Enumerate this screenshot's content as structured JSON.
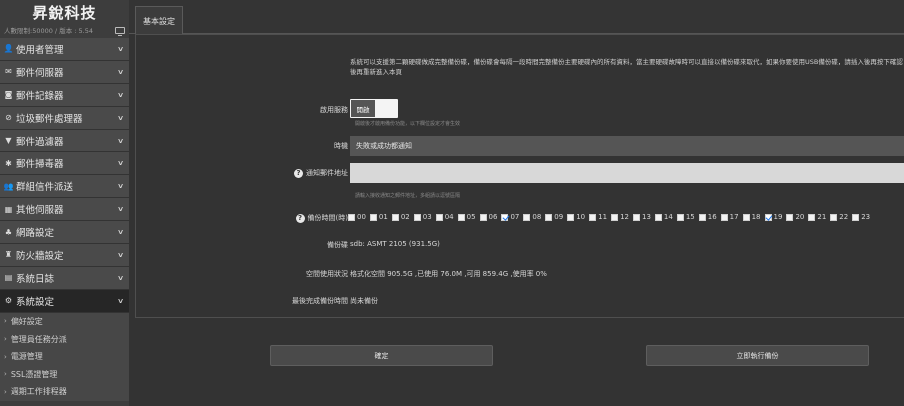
{
  "brand": {
    "title": "昇銳科技"
  },
  "quota": {
    "text": "人數限制:50000 / 版本 : 5.54"
  },
  "sidebar": {
    "items": [
      {
        "label": "使用者管理",
        "icon": "user-icon",
        "glyph": "👤"
      },
      {
        "label": "郵件伺服器",
        "icon": "envelope-icon",
        "glyph": "✉"
      },
      {
        "label": "郵件記錄器",
        "icon": "camera-icon",
        "glyph": "◙"
      },
      {
        "label": "垃圾郵件處理器",
        "icon": "ban-icon",
        "glyph": "⊘"
      },
      {
        "label": "郵件過濾器",
        "icon": "filter-icon",
        "glyph": "▼"
      },
      {
        "label": "郵件掃毒器",
        "icon": "bug-icon",
        "glyph": "✱"
      },
      {
        "label": "群組信件派送",
        "icon": "group-icon",
        "glyph": "👥"
      },
      {
        "label": "其他伺服器",
        "icon": "server-icon",
        "glyph": "▦"
      },
      {
        "label": "網路設定",
        "icon": "network-icon",
        "glyph": "♣"
      },
      {
        "label": "防火牆設定",
        "icon": "firewall-icon",
        "glyph": "♜"
      },
      {
        "label": "系統日誌",
        "icon": "log-icon",
        "glyph": "▤"
      },
      {
        "label": "系統設定",
        "icon": "cogs-icon",
        "glyph": "⚙"
      }
    ],
    "subitems": [
      "偏好設定",
      "管理員任務分派",
      "電源管理",
      "SSL憑證管理",
      "週期工作排程器"
    ]
  },
  "tab": {
    "label": "基本設定"
  },
  "description": "系統可以支援第二顆硬碟做成完整備份碟，備份碟會每隔一段時間完整備份主要硬碟內的所有資料，當主要硬碟故障時可以直接以備份碟來取代，如果你要使用USB備份碟，請插入後再按下確認後再重新進入本頁",
  "form": {
    "enable": {
      "label": "啟用服務",
      "toggle_text": "開啟",
      "hint": "開啟後才啟用備份功能，以下欄位設定才會生效"
    },
    "notify": {
      "label": "時機",
      "value": "失敗或成功都通知"
    },
    "email": {
      "label": "通知郵件地址",
      "value": "",
      "hint": "請輸入接收通知之郵件地址，多組請以逗號區隔"
    },
    "hours": {
      "label": "備份時間(時)",
      "items": [
        {
          "h": "00",
          "checked": false
        },
        {
          "h": "01",
          "checked": false
        },
        {
          "h": "02",
          "checked": false
        },
        {
          "h": "03",
          "checked": false
        },
        {
          "h": "04",
          "checked": false
        },
        {
          "h": "05",
          "checked": false
        },
        {
          "h": "06",
          "checked": false
        },
        {
          "h": "07",
          "checked": true
        },
        {
          "h": "08",
          "checked": false
        },
        {
          "h": "09",
          "checked": false
        },
        {
          "h": "10",
          "checked": false
        },
        {
          "h": "11",
          "checked": false
        },
        {
          "h": "12",
          "checked": false
        },
        {
          "h": "13",
          "checked": false
        },
        {
          "h": "14",
          "checked": false
        },
        {
          "h": "15",
          "checked": false
        },
        {
          "h": "16",
          "checked": false
        },
        {
          "h": "17",
          "checked": false
        },
        {
          "h": "18",
          "checked": false
        },
        {
          "h": "19",
          "checked": true
        },
        {
          "h": "20",
          "checked": false
        },
        {
          "h": "21",
          "checked": false
        },
        {
          "h": "22",
          "checked": false
        },
        {
          "h": "23",
          "checked": false
        }
      ]
    },
    "device": {
      "label": "備份碟",
      "value": "sdb: ASMT 2105 (931.5G)"
    },
    "space": {
      "label": "空間使用狀況",
      "value": "格式化空間 905.5G ,已使用 76.0M ,可用 859.4G ,使用率 0%"
    },
    "last": {
      "label": "最後完成備份時間",
      "value": "尚未備份"
    }
  },
  "buttons": {
    "confirm": "確定",
    "run_now": "立即執行備份"
  }
}
